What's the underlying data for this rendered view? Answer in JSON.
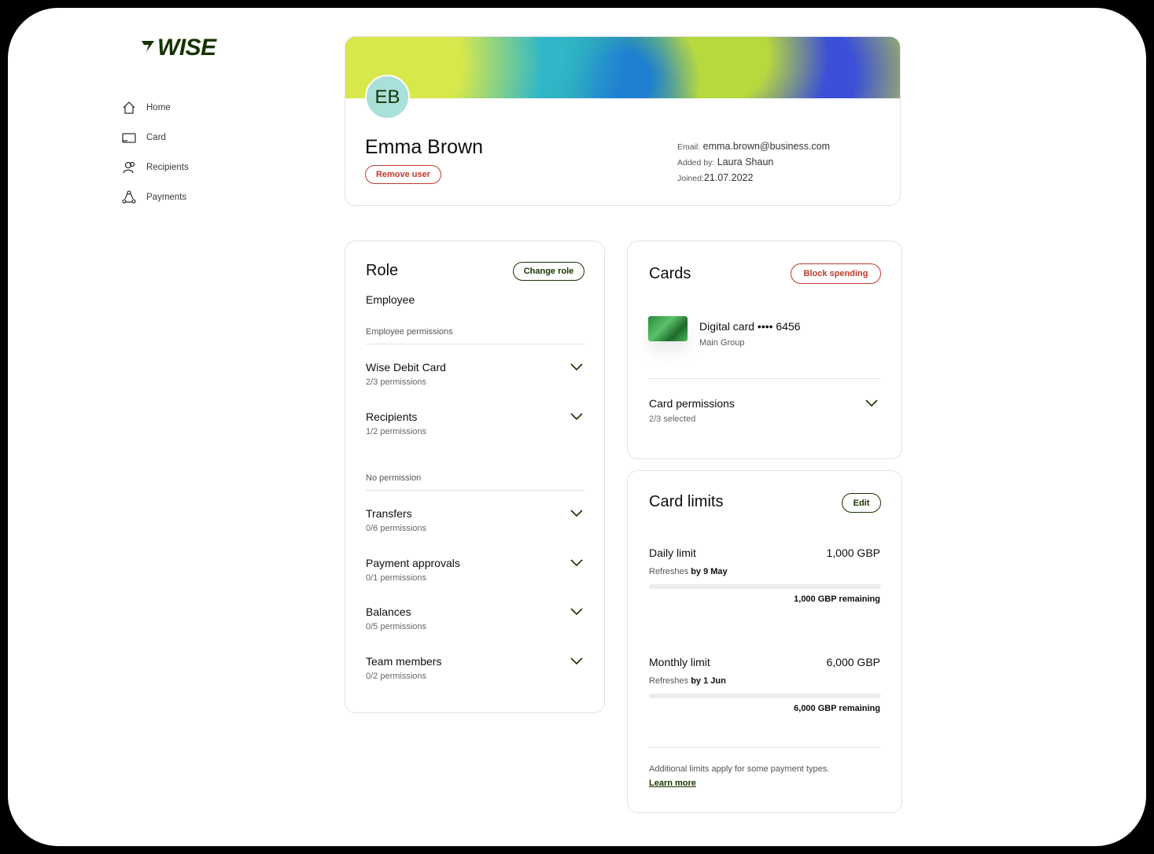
{
  "brand": {
    "logo_text": "WISE",
    "logo_flag": "⁷"
  },
  "sidebar": {
    "items": [
      {
        "label": "Home",
        "icon": "home-icon"
      },
      {
        "label": "Card",
        "icon": "card-icon"
      },
      {
        "label": "Recipients",
        "icon": "recipients-icon"
      },
      {
        "label": "Payments",
        "icon": "payments-icon"
      }
    ]
  },
  "profile": {
    "initials": "EB",
    "name": "Emma Brown",
    "remove_label": "Remove user",
    "email_key": "Email:",
    "email": "emma.brown@business.com",
    "added_key": "Added by:",
    "added_by": "Laura Shaun",
    "joined_key": "Joined:",
    "joined": "21.07.2022"
  },
  "role": {
    "title": "Role",
    "change_label": "Change role",
    "value": "Employee",
    "section1": "Employee permissions",
    "granted": [
      {
        "title": "Wise Debit Card",
        "sub": "2/3 permissions"
      },
      {
        "title": "Recipients",
        "sub": "1/2 permissions"
      }
    ],
    "section2": "No permission",
    "none": [
      {
        "title": "Transfers",
        "sub": "0/6 permissions"
      },
      {
        "title": "Payment approvals",
        "sub": "0/1 permissions"
      },
      {
        "title": "Balances",
        "sub": "0/5 permissions"
      },
      {
        "title": "Team members",
        "sub": "0/2 permissions"
      }
    ]
  },
  "cards": {
    "title": "Cards",
    "block_label": "Block spending",
    "card_name": "Digital card •••• 6456",
    "card_group": "Main Group",
    "perm_title": "Card permissions",
    "perm_sub": "2/3 selected"
  },
  "limits": {
    "title": "Card limits",
    "edit_label": "Edit",
    "daily": {
      "label": "Daily limit",
      "amount": "1,000 GBP",
      "refresh_prefix": "Refreshes",
      "refresh_date": "by 9 May",
      "remaining": "1,000 GBP remaining",
      "used_fraction": 0
    },
    "monthly": {
      "label": "Monthly limit",
      "amount": "6,000 GBP",
      "refresh_prefix": "Refreshes",
      "refresh_date": "by 1 Jun",
      "remaining": "6,000 GBP remaining",
      "used_fraction": 0
    },
    "footnote": "Additional limits apply for some payment types.",
    "learn_more": "Learn more"
  }
}
